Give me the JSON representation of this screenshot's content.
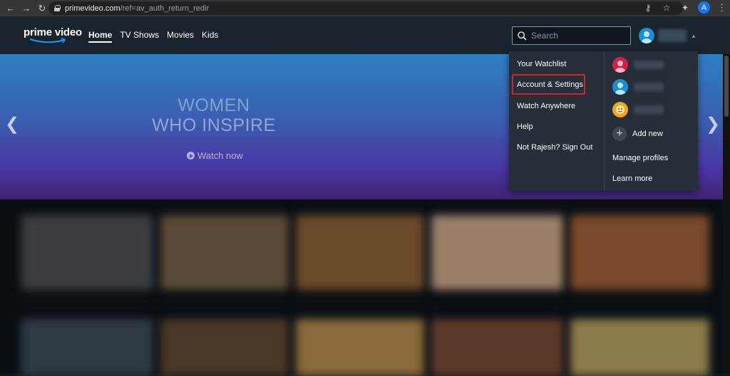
{
  "browser": {
    "url_host": "primevideo.com",
    "url_path": "/ref=av_auth_return_redir",
    "profile_initial": "A",
    "back_glyph": "←",
    "forward_glyph": "→",
    "reload_glyph": "↻",
    "key_glyph": "⚷",
    "star_glyph": "☆",
    "puzzle_glyph": "✦",
    "menu_glyph": "⋮"
  },
  "header": {
    "logo": "prime video",
    "nav": [
      "Home",
      "TV Shows",
      "Movies",
      "Kids"
    ],
    "search_placeholder": "Search",
    "caret_glyph": "▲"
  },
  "hero": {
    "title_line1": "WOMEN",
    "title_line2": "WHO INSPIRE",
    "cta": "Watch now",
    "prev_glyph": "❮",
    "next_glyph": "❯"
  },
  "dropdown": {
    "left_items": [
      "Your Watchlist",
      "Account & Settings",
      "Watch Anywhere",
      "Help",
      "Not Rajesh? Sign Out"
    ],
    "highlighted_item": "Account & Settings",
    "add_new": "Add new",
    "add_glyph": "+",
    "manage_profiles": "Manage profiles",
    "learn_more": "Learn more"
  },
  "colors": {
    "header_bg": "#1a242f",
    "highlight_border": "#d3222a",
    "profile_1": "#d0204a",
    "profile_2": "#1b8ecf",
    "profile_3": "#f2a81d"
  }
}
